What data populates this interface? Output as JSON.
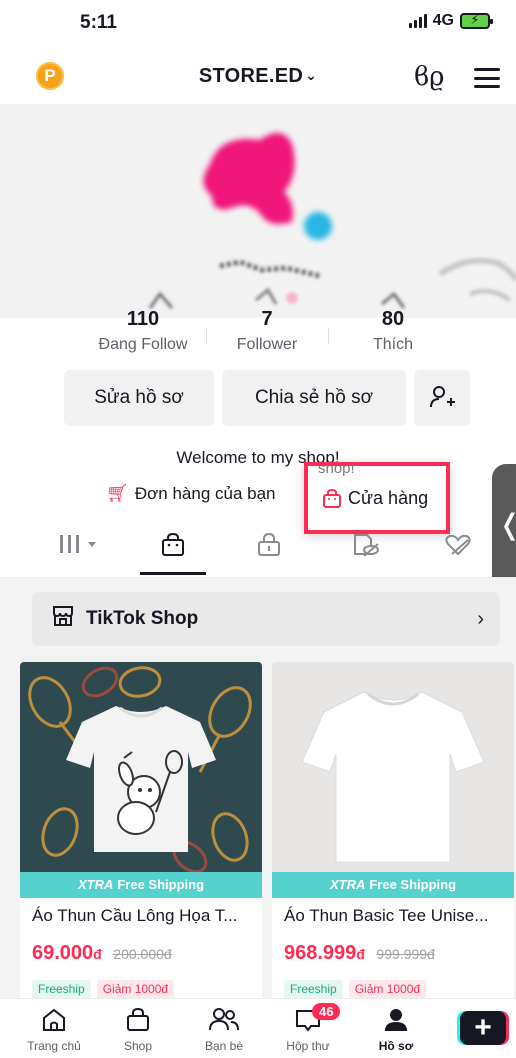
{
  "status_bar": {
    "time": "5:11",
    "network": "4G"
  },
  "header": {
    "coin_letter": "P",
    "account_name": "STORE.ED",
    "chevron": "⌄"
  },
  "stats": [
    {
      "value": "110",
      "label": "Đang Follow"
    },
    {
      "value": "7",
      "label": "Follower"
    },
    {
      "value": "80",
      "label": "Thích"
    }
  ],
  "buttons": {
    "edit": "Sửa hồ sơ",
    "share": "Chia sẻ hồ sơ"
  },
  "bio": "Welcome to my shop!",
  "orders_link": "Đơn hàng của bạn",
  "shop_link": {
    "faded": "shop!",
    "label": "Cửa hàng"
  },
  "tiktok_shop": {
    "label": "TikTok Shop"
  },
  "products": [
    {
      "ship_brand": "XTRA",
      "ship_label": "Free Shipping",
      "title": "Áo Thun Cầu Lông Họa T...",
      "price": "69.000",
      "currency": "đ",
      "old_price": "200.000đ",
      "tags": [
        "Freeship",
        "Giảm 1000đ"
      ]
    },
    {
      "ship_brand": "XTRA",
      "ship_label": "Free Shipping",
      "title": "Áo Thun Basic Tee Unise...",
      "price": "968.999",
      "currency": "đ",
      "old_price": "999.999đ",
      "tags": [
        "Freeship",
        "Giảm 1000đ"
      ]
    }
  ],
  "nav": {
    "home": "Trang chủ",
    "shop": "Shop",
    "friends": "Bạn bè",
    "inbox": "Hộp thư",
    "inbox_badge": "46",
    "profile": "Hồ sơ"
  },
  "colors": {
    "accent": "#fe2c55",
    "teal": "#55d1ce",
    "coin": "#f7a21b"
  },
  "icons": [
    "coin-icon",
    "menu-icon",
    "cart-icon",
    "bag-icon",
    "add-friend-icon",
    "storefront-icon",
    "home-icon",
    "inbox-icon",
    "profile-icon",
    "create-icon"
  ]
}
